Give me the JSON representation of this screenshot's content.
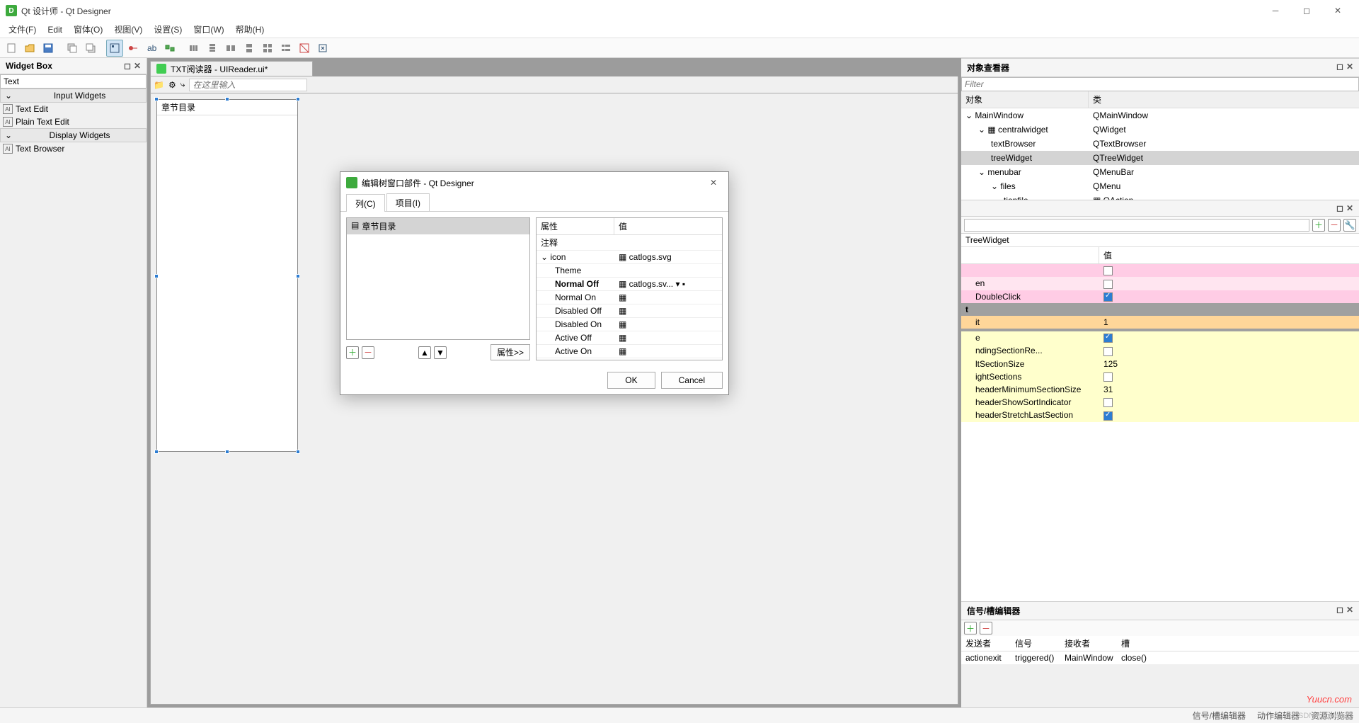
{
  "title": "Qt 设计师 - Qt Designer",
  "menu": [
    "文件(F)",
    "Edit",
    "窗体(O)",
    "视图(V)",
    "设置(S)",
    "窗口(W)",
    "帮助(H)"
  ],
  "widgetBox": {
    "title": "Widget Box",
    "filter": "Text",
    "sections": [
      {
        "name": "Input Widgets",
        "items": [
          "Text Edit",
          "Plain Text Edit"
        ]
      },
      {
        "name": "Display Widgets",
        "items": [
          "Text Browser"
        ]
      }
    ]
  },
  "mdi": {
    "tab": "TXT阅读器 - UIReader.ui*",
    "placeholder": "在这里输入",
    "treeHeader": "章节目录"
  },
  "objInspector": {
    "title": "对象查看器",
    "filter": "Filter",
    "cols": [
      "对象",
      "类"
    ],
    "rows": [
      {
        "indent": 0,
        "name": "MainWindow",
        "cls": "QMainWindow",
        "exp": true
      },
      {
        "indent": 1,
        "name": "centralwidget",
        "cls": "QWidget",
        "exp": true,
        "ico": true
      },
      {
        "indent": 2,
        "name": "textBrowser",
        "cls": "QTextBrowser"
      },
      {
        "indent": 2,
        "name": "treeWidget",
        "cls": "QTreeWidget",
        "sel": true
      },
      {
        "indent": 1,
        "name": "menubar",
        "cls": "QMenuBar",
        "exp": true
      },
      {
        "indent": 2,
        "name": "files",
        "cls": "QMenu",
        "exp": true,
        "cut": true
      },
      {
        "indent": 3,
        "name": "tionfile",
        "cls": "QAction",
        "ico2": true,
        "cut": true
      }
    ]
  },
  "propEditor": {
    "header": "TreeWidget",
    "cols": [
      "",
      "值"
    ],
    "rows": [
      {
        "name": "",
        "val": "",
        "cls": "pink",
        "cb": false
      },
      {
        "name": "en",
        "val": "",
        "cls": "lpink",
        "cb": false
      },
      {
        "name": "DoubleClick",
        "val": "",
        "cls": "pink",
        "cb": true
      },
      {
        "name": "t",
        "val": "",
        "cls": "group"
      },
      {
        "name": "it",
        "val": "1",
        "cls": "orange"
      },
      {
        "name": "",
        "val": "",
        "cls": "group2"
      },
      {
        "name": "e",
        "val": "",
        "cls": "yellow",
        "cb": true
      },
      {
        "name": "ndingSectionRe...",
        "val": "",
        "cls": "yellow",
        "cb": false
      },
      {
        "name": "ltSectionSize",
        "val": "125",
        "cls": "yellow"
      },
      {
        "name": "ightSections",
        "val": "",
        "cls": "yellow",
        "cb": false
      },
      {
        "name": "headerMinimumSectionSize",
        "val": "31",
        "cls": "yellow"
      },
      {
        "name": "headerShowSortIndicator",
        "val": "",
        "cls": "yellow",
        "cb": false
      },
      {
        "name": "headerStretchLastSection",
        "val": "",
        "cls": "yellow",
        "cb": true
      }
    ]
  },
  "sigSlot": {
    "title": "信号/槽编辑器",
    "cols": [
      "发送者",
      "信号",
      "接收者",
      "槽"
    ],
    "row": [
      "actionexit",
      "triggered()",
      "MainWindow",
      "close()"
    ]
  },
  "dialog": {
    "title": "编辑树窗口部件 - Qt Designer",
    "tabs": [
      "列(C)",
      "项目(I)"
    ],
    "listItem": "章节目录",
    "propBtn": "属性>>",
    "propCols": [
      "属性",
      "值"
    ],
    "propRows": [
      {
        "n": "注释",
        "v": ""
      },
      {
        "n": "icon",
        "v": "catlogs.svg",
        "exp": true,
        "ico": true
      },
      {
        "n": "Theme",
        "v": "",
        "indent": 1
      },
      {
        "n": "Normal Off",
        "v": "catlogs.sv...",
        "indent": 1,
        "bold": true,
        "combo": true
      },
      {
        "n": "Normal On",
        "v": "",
        "indent": 1,
        "ico": true
      },
      {
        "n": "Disabled Off",
        "v": "",
        "indent": 1,
        "ico": true
      },
      {
        "n": "Disabled On",
        "v": "",
        "indent": 1,
        "ico": true
      },
      {
        "n": "Active Off",
        "v": "",
        "indent": 1,
        "ico": true
      },
      {
        "n": "Active On",
        "v": "",
        "indent": 1,
        "ico": true
      }
    ],
    "ok": "OK",
    "cancel": "Cancel"
  },
  "status": [
    "信号/槽编辑器",
    "动作编辑器",
    "资源浏览器"
  ],
  "watermark1": "Yuucn.com",
  "watermark2": "CSDN @pikeduo"
}
